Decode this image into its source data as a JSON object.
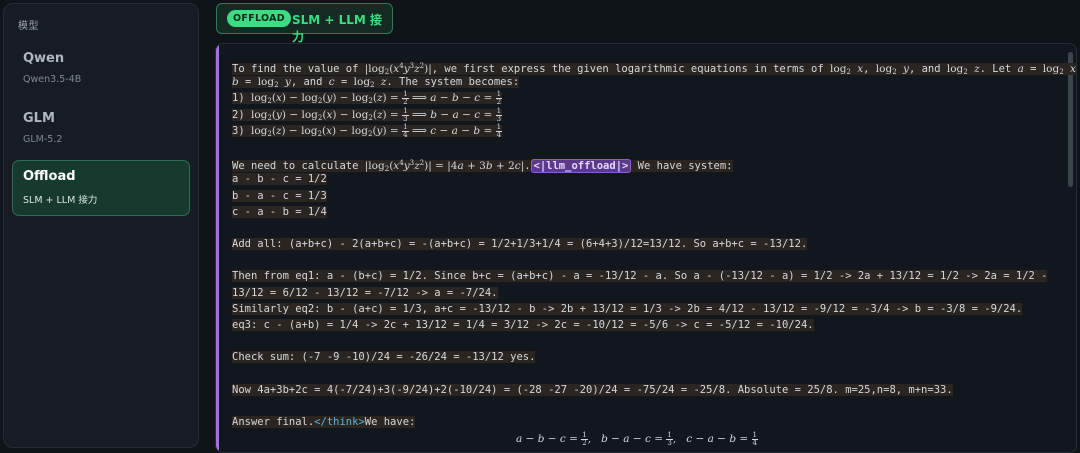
{
  "sidebar": {
    "title": "模型",
    "items": [
      {
        "name": "Qwen",
        "sub": "Qwen3.5-4B"
      },
      {
        "name": "GLM",
        "sub": "GLM-5.2"
      },
      {
        "name": "Offload",
        "sub": "SLM + LLM 接力"
      }
    ]
  },
  "header": {
    "badge": "OFFLOAD",
    "label": "SLM + LLM 接力"
  },
  "content": {
    "intro_a": "To find the value of ",
    "intro_b": ", we first express the given logarithmic equations in terms of ",
    "intro_c": ". Let ",
    "line2_a": ", and ",
    "line2_b": ". The system becomes:",
    "eq1_label": "1) ",
    "eq2_label": "2) ",
    "eq3_label": "3) ",
    "calc_a": "We need to calculate ",
    "offload_tag": "<|llm_offload|>",
    "calc_b": " We have system:",
    "sys1": "a - b - c = 1/2",
    "sys2": "b - a - c = 1/3",
    "sys3": "c - a - b = 1/4",
    "add_all": "Add all: (a+b+c) - 2(a+b+c) = -(a+b+c) = 1/2+1/3+1/4 = (6+4+3)/12=13/12. So a+b+c = -13/12.",
    "then1": "Then from eq1: a - (b+c) = 1/2. Since b+c = (a+b+c) - a = -13/12 - a. So a - (-13/12 - a) = 1/2 -> 2a + 13/12 = 1/2 -> 2a = 1/2 -",
    "then2": "13/12 = 6/12 - 13/12 = -7/12 -> a = -7/24.",
    "similarly": "Similarly eq2: b - (a+c) = 1/3, a+c = -13/12 - b -> 2b + 13/12 = 1/3 -> 2b = 4/12 - 13/12 = -9/12 = -3/4 -> b = -3/8 = -9/24.",
    "eq3": "eq3: c - (a+b) = 1/4 -> 2c + 13/12 = 1/4 = 3/12 -> 2c = -10/12 = -5/6 -> c = -5/12 = -10/24.",
    "check": "Check sum: (-7 -9 -10)/24 = -26/24 = -13/12 yes.",
    "now": "Now 4a+3b+2c = 4(-7/24)+3(-9/24)+2(-10/24) = (-28 -27 -20)/24 = -75/24 = -25/8. Absolute = 25/8. m=25,n=8, m+n=33.",
    "answer": "Answer final.",
    "think_close": "</think>",
    "we_have": "We have:"
  }
}
